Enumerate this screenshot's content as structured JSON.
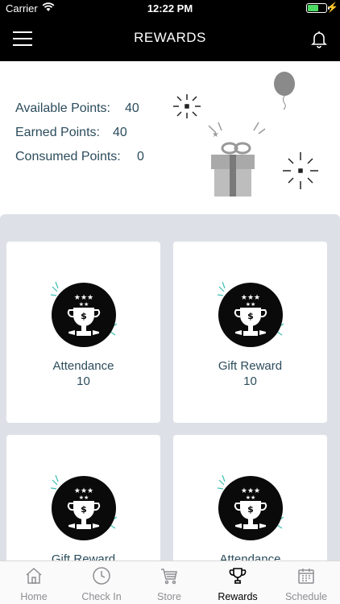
{
  "status_bar": {
    "carrier": "Carrier",
    "time": "12:22 PM",
    "battery_level": 0.6
  },
  "navbar": {
    "title": "REWARDS",
    "menu_icon": "hamburger-icon",
    "notification_icon": "bell-icon"
  },
  "points": {
    "available_label": "Available Points:",
    "available_value": "40",
    "earned_label": "Earned Points:",
    "earned_value": "40",
    "consumed_label": "Consumed Points:",
    "consumed_value": "0"
  },
  "rewards": [
    {
      "name": "Attendance",
      "count": "10"
    },
    {
      "name": "Gift Reward",
      "count": "10"
    },
    {
      "name": "Gift Reward",
      "count": ""
    },
    {
      "name": "Attendance",
      "count": ""
    }
  ],
  "tabs": [
    {
      "label": "Home",
      "icon": "home-icon"
    },
    {
      "label": "Check In",
      "icon": "clock-icon"
    },
    {
      "label": "Store",
      "icon": "cart-icon"
    },
    {
      "label": "Rewards",
      "icon": "trophy-icon",
      "active": true
    },
    {
      "label": "Schedule",
      "icon": "calendar-icon"
    }
  ],
  "colors": {
    "accent_text": "#2c4c5c",
    "teal_sparkle": "#3bbfb0",
    "grid_bg": "#dde1e7"
  }
}
